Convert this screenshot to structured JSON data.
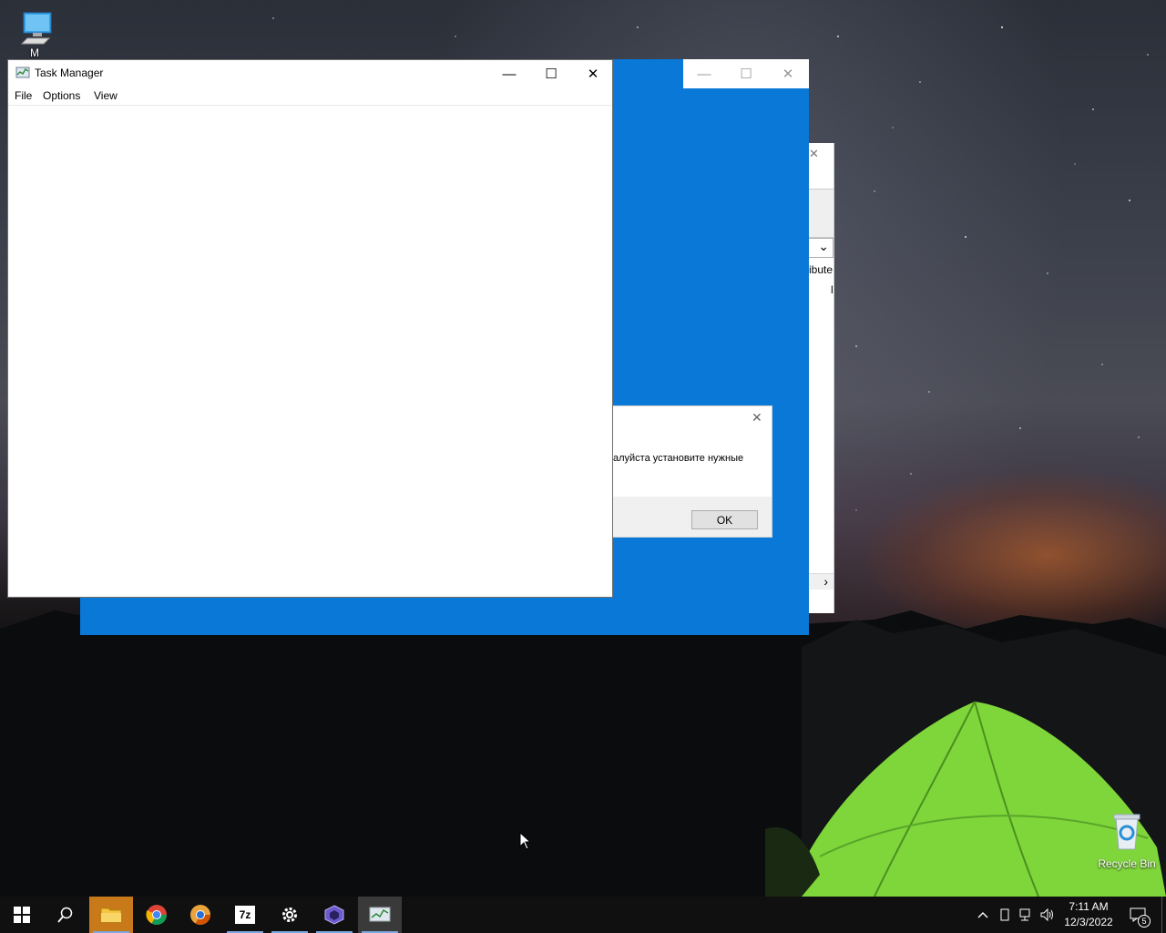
{
  "desktop": {
    "icons": [
      {
        "label": "M",
        "icon": "this-pc-icon"
      },
      {
        "label": "Recycle Bin",
        "icon": "recycle-bin-icon"
      }
    ]
  },
  "task_manager": {
    "title": "Task Manager",
    "menu": [
      "File",
      "Options",
      "View"
    ],
    "controls": {
      "minimize": "—",
      "maximize": "☐",
      "close": "✕"
    }
  },
  "background_window": {
    "controls": {
      "minimize": "—",
      "maximize": "☐",
      "close": "✕"
    },
    "accent": "#0a78d7"
  },
  "side_window": {
    "close": "✕",
    "text_fragment_1": "ibute",
    "text_fragment_2": "l",
    "chevron_down": "⌄",
    "chevron_right": "›"
  },
  "message_box": {
    "close": "✕",
    "text": "алуйста установите нужные",
    "ok_label": "OK"
  },
  "taskbar": {
    "apps": [
      {
        "name": "start",
        "icon": "windows-icon"
      },
      {
        "name": "search",
        "icon": "search-icon"
      },
      {
        "name": "file-explorer",
        "icon": "folder-icon",
        "active": true
      },
      {
        "name": "chrome",
        "icon": "chrome-icon"
      },
      {
        "name": "chromium",
        "icon": "chromium-icon"
      },
      {
        "name": "7zip",
        "icon": "7zip-icon",
        "label": "7z"
      },
      {
        "name": "settings",
        "icon": "gear-icon"
      },
      {
        "name": "cube-app",
        "icon": "cube-icon"
      },
      {
        "name": "task-manager",
        "icon": "task-manager-icon",
        "active": true
      }
    ],
    "clock_time": "7:11 AM",
    "clock_date": "12/3/2022",
    "notification_count": "5"
  }
}
